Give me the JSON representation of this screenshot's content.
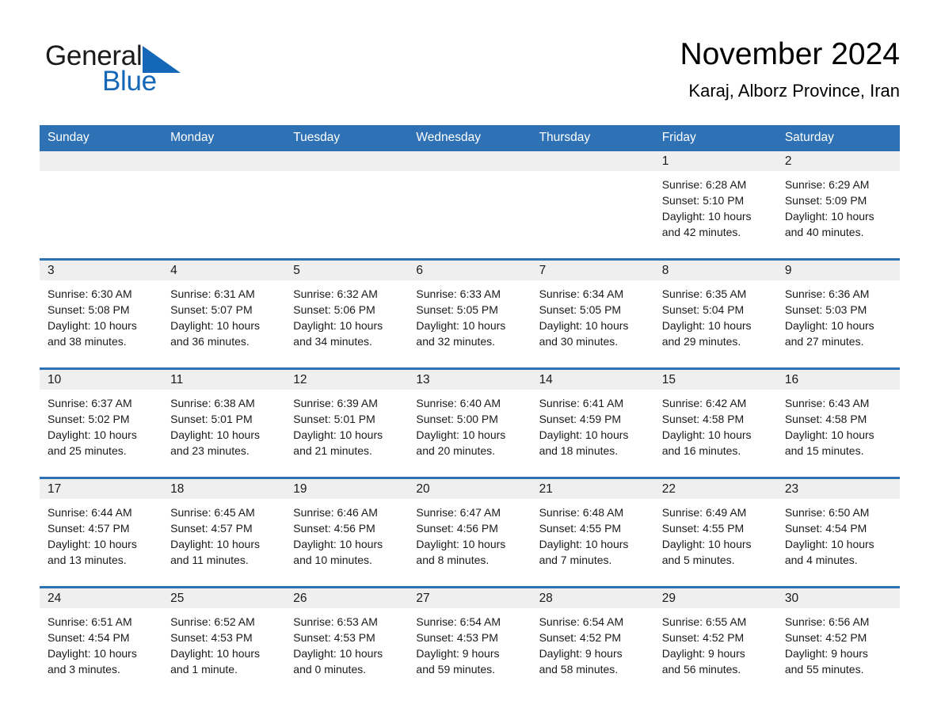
{
  "brand": {
    "name_part1": "General",
    "name_part2": "Blue",
    "triangle_color": "#1568b8",
    "text_color_primary": "#1a1a1a",
    "text_color_accent": "#1568b8"
  },
  "header": {
    "title": "November 2024",
    "location": "Karaj, Alborz Province, Iran"
  },
  "theme": {
    "header_blue": "#2e71b5",
    "daynum_band": "#efefef",
    "cell_background": "#ffffff"
  },
  "weekday_headers": [
    "Sunday",
    "Monday",
    "Tuesday",
    "Wednesday",
    "Thursday",
    "Friday",
    "Saturday"
  ],
  "weeks": [
    [
      {
        "day": "",
        "empty": true,
        "sunrise": "",
        "sunset": "",
        "daylight_line1": "",
        "daylight_line2": ""
      },
      {
        "day": "",
        "empty": true,
        "sunrise": "",
        "sunset": "",
        "daylight_line1": "",
        "daylight_line2": ""
      },
      {
        "day": "",
        "empty": true,
        "sunrise": "",
        "sunset": "",
        "daylight_line1": "",
        "daylight_line2": ""
      },
      {
        "day": "",
        "empty": true,
        "sunrise": "",
        "sunset": "",
        "daylight_line1": "",
        "daylight_line2": ""
      },
      {
        "day": "",
        "empty": true,
        "sunrise": "",
        "sunset": "",
        "daylight_line1": "",
        "daylight_line2": ""
      },
      {
        "day": "1",
        "empty": false,
        "sunrise": "Sunrise: 6:28 AM",
        "sunset": "Sunset: 5:10 PM",
        "daylight_line1": "Daylight: 10 hours",
        "daylight_line2": "and 42 minutes."
      },
      {
        "day": "2",
        "empty": false,
        "sunrise": "Sunrise: 6:29 AM",
        "sunset": "Sunset: 5:09 PM",
        "daylight_line1": "Daylight: 10 hours",
        "daylight_line2": "and 40 minutes."
      }
    ],
    [
      {
        "day": "3",
        "empty": false,
        "sunrise": "Sunrise: 6:30 AM",
        "sunset": "Sunset: 5:08 PM",
        "daylight_line1": "Daylight: 10 hours",
        "daylight_line2": "and 38 minutes."
      },
      {
        "day": "4",
        "empty": false,
        "sunrise": "Sunrise: 6:31 AM",
        "sunset": "Sunset: 5:07 PM",
        "daylight_line1": "Daylight: 10 hours",
        "daylight_line2": "and 36 minutes."
      },
      {
        "day": "5",
        "empty": false,
        "sunrise": "Sunrise: 6:32 AM",
        "sunset": "Sunset: 5:06 PM",
        "daylight_line1": "Daylight: 10 hours",
        "daylight_line2": "and 34 minutes."
      },
      {
        "day": "6",
        "empty": false,
        "sunrise": "Sunrise: 6:33 AM",
        "sunset": "Sunset: 5:05 PM",
        "daylight_line1": "Daylight: 10 hours",
        "daylight_line2": "and 32 minutes."
      },
      {
        "day": "7",
        "empty": false,
        "sunrise": "Sunrise: 6:34 AM",
        "sunset": "Sunset: 5:05 PM",
        "daylight_line1": "Daylight: 10 hours",
        "daylight_line2": "and 30 minutes."
      },
      {
        "day": "8",
        "empty": false,
        "sunrise": "Sunrise: 6:35 AM",
        "sunset": "Sunset: 5:04 PM",
        "daylight_line1": "Daylight: 10 hours",
        "daylight_line2": "and 29 minutes."
      },
      {
        "day": "9",
        "empty": false,
        "sunrise": "Sunrise: 6:36 AM",
        "sunset": "Sunset: 5:03 PM",
        "daylight_line1": "Daylight: 10 hours",
        "daylight_line2": "and 27 minutes."
      }
    ],
    [
      {
        "day": "10",
        "empty": false,
        "sunrise": "Sunrise: 6:37 AM",
        "sunset": "Sunset: 5:02 PM",
        "daylight_line1": "Daylight: 10 hours",
        "daylight_line2": "and 25 minutes."
      },
      {
        "day": "11",
        "empty": false,
        "sunrise": "Sunrise: 6:38 AM",
        "sunset": "Sunset: 5:01 PM",
        "daylight_line1": "Daylight: 10 hours",
        "daylight_line2": "and 23 minutes."
      },
      {
        "day": "12",
        "empty": false,
        "sunrise": "Sunrise: 6:39 AM",
        "sunset": "Sunset: 5:01 PM",
        "daylight_line1": "Daylight: 10 hours",
        "daylight_line2": "and 21 minutes."
      },
      {
        "day": "13",
        "empty": false,
        "sunrise": "Sunrise: 6:40 AM",
        "sunset": "Sunset: 5:00 PM",
        "daylight_line1": "Daylight: 10 hours",
        "daylight_line2": "and 20 minutes."
      },
      {
        "day": "14",
        "empty": false,
        "sunrise": "Sunrise: 6:41 AM",
        "sunset": "Sunset: 4:59 PM",
        "daylight_line1": "Daylight: 10 hours",
        "daylight_line2": "and 18 minutes."
      },
      {
        "day": "15",
        "empty": false,
        "sunrise": "Sunrise: 6:42 AM",
        "sunset": "Sunset: 4:58 PM",
        "daylight_line1": "Daylight: 10 hours",
        "daylight_line2": "and 16 minutes."
      },
      {
        "day": "16",
        "empty": false,
        "sunrise": "Sunrise: 6:43 AM",
        "sunset": "Sunset: 4:58 PM",
        "daylight_line1": "Daylight: 10 hours",
        "daylight_line2": "and 15 minutes."
      }
    ],
    [
      {
        "day": "17",
        "empty": false,
        "sunrise": "Sunrise: 6:44 AM",
        "sunset": "Sunset: 4:57 PM",
        "daylight_line1": "Daylight: 10 hours",
        "daylight_line2": "and 13 minutes."
      },
      {
        "day": "18",
        "empty": false,
        "sunrise": "Sunrise: 6:45 AM",
        "sunset": "Sunset: 4:57 PM",
        "daylight_line1": "Daylight: 10 hours",
        "daylight_line2": "and 11 minutes."
      },
      {
        "day": "19",
        "empty": false,
        "sunrise": "Sunrise: 6:46 AM",
        "sunset": "Sunset: 4:56 PM",
        "daylight_line1": "Daylight: 10 hours",
        "daylight_line2": "and 10 minutes."
      },
      {
        "day": "20",
        "empty": false,
        "sunrise": "Sunrise: 6:47 AM",
        "sunset": "Sunset: 4:56 PM",
        "daylight_line1": "Daylight: 10 hours",
        "daylight_line2": "and 8 minutes."
      },
      {
        "day": "21",
        "empty": false,
        "sunrise": "Sunrise: 6:48 AM",
        "sunset": "Sunset: 4:55 PM",
        "daylight_line1": "Daylight: 10 hours",
        "daylight_line2": "and 7 minutes."
      },
      {
        "day": "22",
        "empty": false,
        "sunrise": "Sunrise: 6:49 AM",
        "sunset": "Sunset: 4:55 PM",
        "daylight_line1": "Daylight: 10 hours",
        "daylight_line2": "and 5 minutes."
      },
      {
        "day": "23",
        "empty": false,
        "sunrise": "Sunrise: 6:50 AM",
        "sunset": "Sunset: 4:54 PM",
        "daylight_line1": "Daylight: 10 hours",
        "daylight_line2": "and 4 minutes."
      }
    ],
    [
      {
        "day": "24",
        "empty": false,
        "sunrise": "Sunrise: 6:51 AM",
        "sunset": "Sunset: 4:54 PM",
        "daylight_line1": "Daylight: 10 hours",
        "daylight_line2": "and 3 minutes."
      },
      {
        "day": "25",
        "empty": false,
        "sunrise": "Sunrise: 6:52 AM",
        "sunset": "Sunset: 4:53 PM",
        "daylight_line1": "Daylight: 10 hours",
        "daylight_line2": "and 1 minute."
      },
      {
        "day": "26",
        "empty": false,
        "sunrise": "Sunrise: 6:53 AM",
        "sunset": "Sunset: 4:53 PM",
        "daylight_line1": "Daylight: 10 hours",
        "daylight_line2": "and 0 minutes."
      },
      {
        "day": "27",
        "empty": false,
        "sunrise": "Sunrise: 6:54 AM",
        "sunset": "Sunset: 4:53 PM",
        "daylight_line1": "Daylight: 9 hours",
        "daylight_line2": "and 59 minutes."
      },
      {
        "day": "28",
        "empty": false,
        "sunrise": "Sunrise: 6:54 AM",
        "sunset": "Sunset: 4:52 PM",
        "daylight_line1": "Daylight: 9 hours",
        "daylight_line2": "and 58 minutes."
      },
      {
        "day": "29",
        "empty": false,
        "sunrise": "Sunrise: 6:55 AM",
        "sunset": "Sunset: 4:52 PM",
        "daylight_line1": "Daylight: 9 hours",
        "daylight_line2": "and 56 minutes."
      },
      {
        "day": "30",
        "empty": false,
        "sunrise": "Sunrise: 6:56 AM",
        "sunset": "Sunset: 4:52 PM",
        "daylight_line1": "Daylight: 9 hours",
        "daylight_line2": "and 55 minutes."
      }
    ]
  ]
}
